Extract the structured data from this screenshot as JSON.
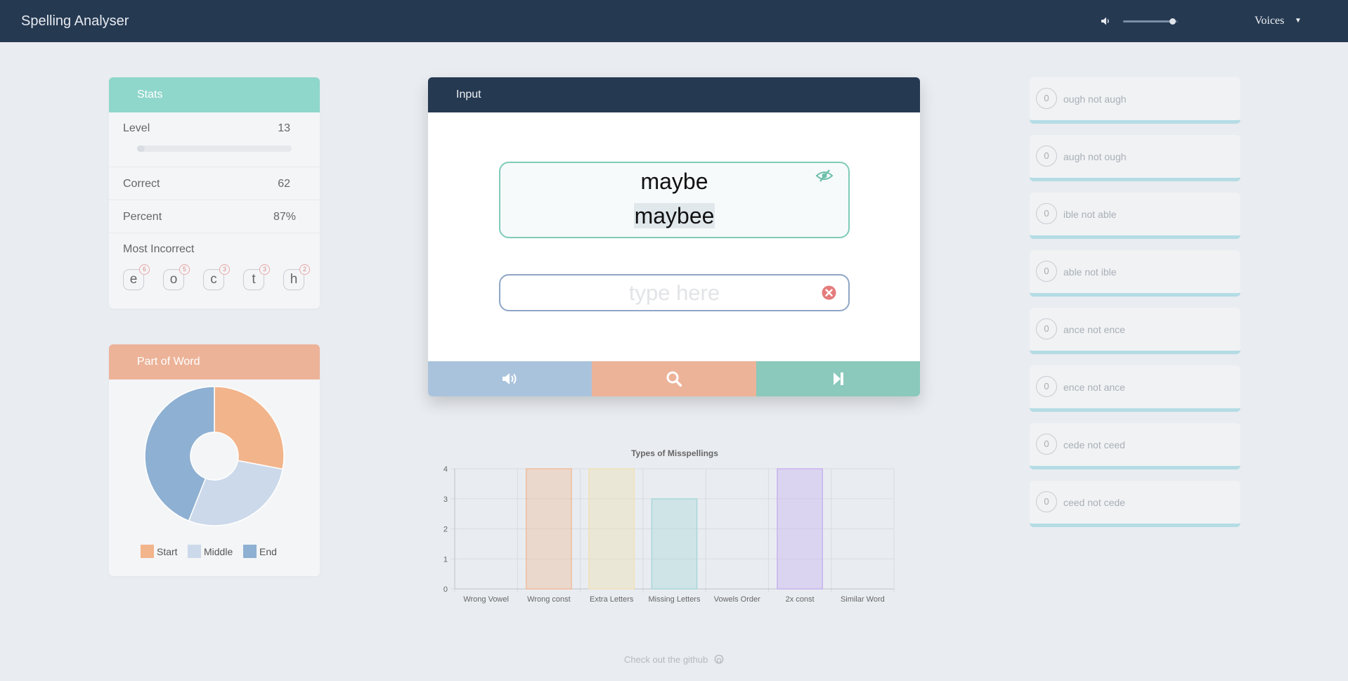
{
  "header": {
    "title": "Spelling Analyser",
    "volume_icon": "volume-icon",
    "volume_level": 0.9,
    "voices_label": "Voices",
    "voices_caret": "▼"
  },
  "stats": {
    "title": "Stats",
    "level_label": "Level",
    "level_value": "13",
    "level_progress": 0.05,
    "correct_label": "Correct",
    "correct_value": "62",
    "percent_label": "Percent",
    "percent_value": "87%",
    "most_incorrect_label": "Most Incorrect",
    "letters": [
      {
        "letter": "e",
        "count": "6"
      },
      {
        "letter": "o",
        "count": "5"
      },
      {
        "letter": "c",
        "count": "3"
      },
      {
        "letter": "t",
        "count": "3"
      },
      {
        "letter": "h",
        "count": "2"
      }
    ]
  },
  "part_of_word": {
    "title": "Part of Word",
    "legend": [
      {
        "label": "Start",
        "color": "#f2b48b"
      },
      {
        "label": "Middle",
        "color": "#ccd9ea"
      },
      {
        "label": "End",
        "color": "#8eb0d2"
      }
    ],
    "slices": [
      28,
      28,
      44
    ]
  },
  "input_panel": {
    "title": "Input",
    "target_word": "maybe",
    "attempt_word": "maybee",
    "placeholder": "type here",
    "eye_icon": "eye-slash-icon",
    "clear_icon": "clear-icon",
    "buttons": [
      {
        "icon": "speaker-icon",
        "color": "#aac3dd"
      },
      {
        "icon": "magnifier-icon",
        "color": "#ecb399"
      },
      {
        "icon": "skip-forward-icon",
        "color": "#8ac9bb"
      }
    ]
  },
  "chart_data": {
    "type": "bar",
    "title": "Types of Misspellings",
    "categories": [
      "Wrong Vowel",
      "Wrong const",
      "Extra Letters",
      "Missing Letters",
      "Vowels Order",
      "2x const",
      "Similar Word"
    ],
    "values": [
      0,
      4,
      4,
      3,
      0,
      4,
      0
    ],
    "colors": [
      "#f2b48b",
      "#f2b48b",
      "#f2dfaa",
      "#9fd6d8",
      "#ccd9ea",
      "#c3a8f0",
      "#ccd9ea"
    ],
    "ylim": [
      0,
      4
    ],
    "yticks": [
      "0",
      "1",
      "2",
      "3",
      "4"
    ],
    "grid": true
  },
  "rules": [
    {
      "count": "0",
      "label": "ough not augh"
    },
    {
      "count": "0",
      "label": "augh not ough"
    },
    {
      "count": "0",
      "label": "ible not able"
    },
    {
      "count": "0",
      "label": "able not ible"
    },
    {
      "count": "0",
      "label": "ance not ence"
    },
    {
      "count": "0",
      "label": "ence not ance"
    },
    {
      "count": "0",
      "label": "cede not ceed"
    },
    {
      "count": "0",
      "label": "ceed not cede"
    }
  ],
  "footer": {
    "text": "Check out the github",
    "icon": "github-icon"
  }
}
